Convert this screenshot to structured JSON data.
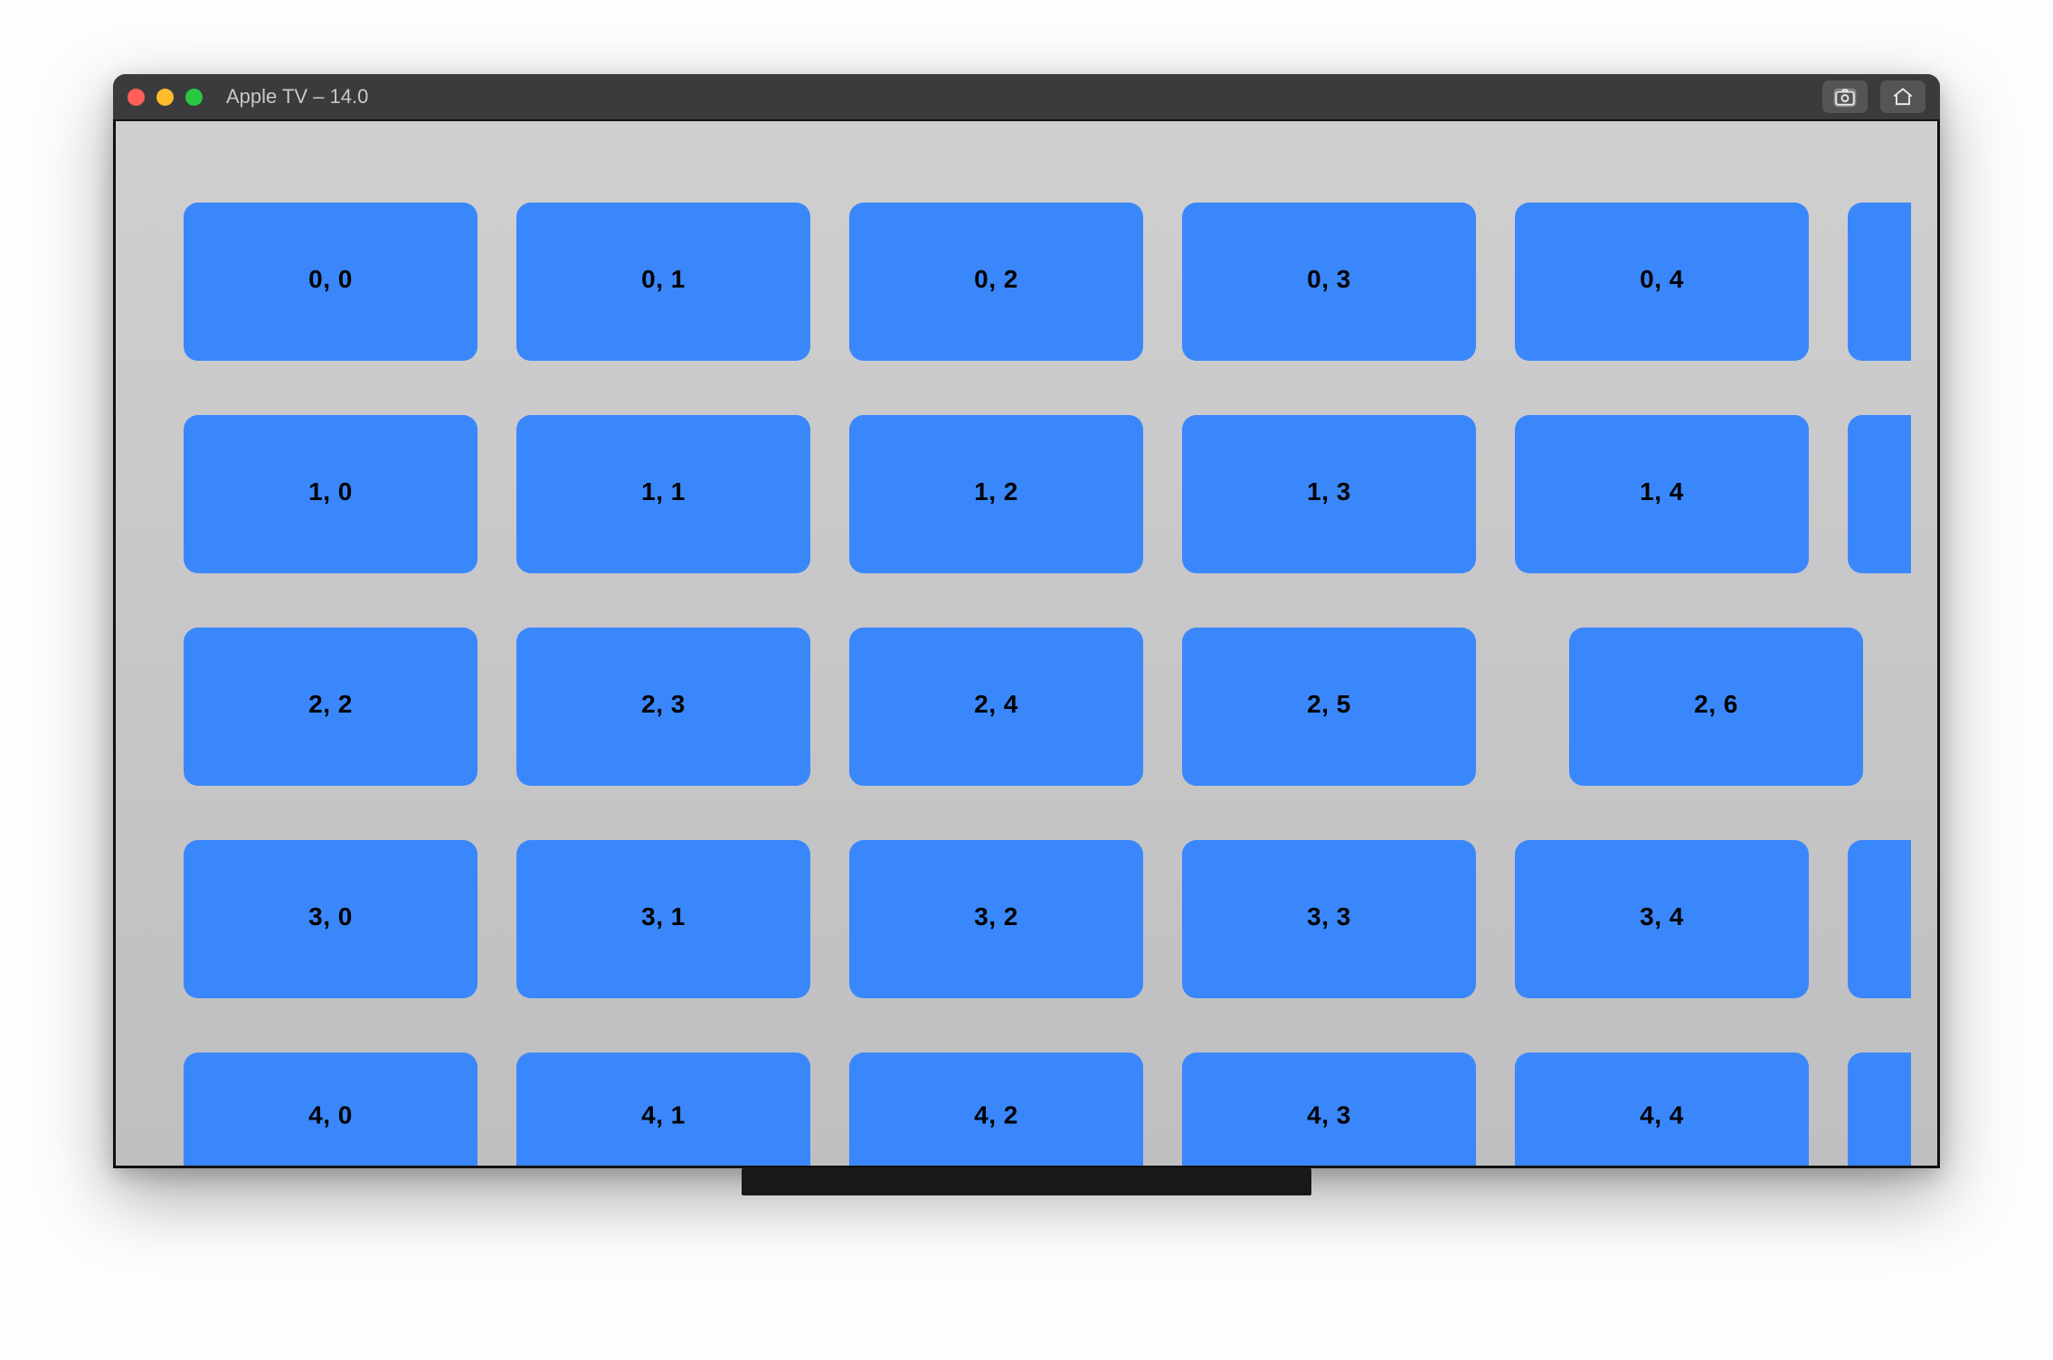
{
  "window": {
    "title": "Apple TV – 14.0"
  },
  "toolbar": {
    "screenshot_icon": "camera-icon",
    "home_icon": "home-icon"
  },
  "grid": {
    "card_color": "#3a87fb",
    "background_color": "#bfbfc1",
    "rows": [
      {
        "offset_cols": 0,
        "cells": [
          "0, 0",
          "0, 1",
          "0, 2",
          "0, 3",
          "0, 4"
        ],
        "partial_right": true
      },
      {
        "offset_cols": 0,
        "cells": [
          "1, 0",
          "1, 1",
          "1, 2",
          "1, 3",
          "1, 4"
        ],
        "partial_right": true
      },
      {
        "offset_cols": -1,
        "cells": [
          "2, 2",
          "2, 3",
          "2, 4",
          "2, 5",
          "2, 6"
        ],
        "partial_right": false,
        "partial_left": true
      },
      {
        "offset_cols": 0,
        "cells": [
          "3, 0",
          "3, 1",
          "3, 2",
          "3, 3",
          "3, 4"
        ],
        "partial_right": true
      },
      {
        "offset_cols": 0,
        "cells": [
          "4, 0",
          "4, 1",
          "4, 2",
          "4, 3",
          "4, 4"
        ],
        "partial_right": true,
        "partial_bottom": true
      }
    ]
  }
}
